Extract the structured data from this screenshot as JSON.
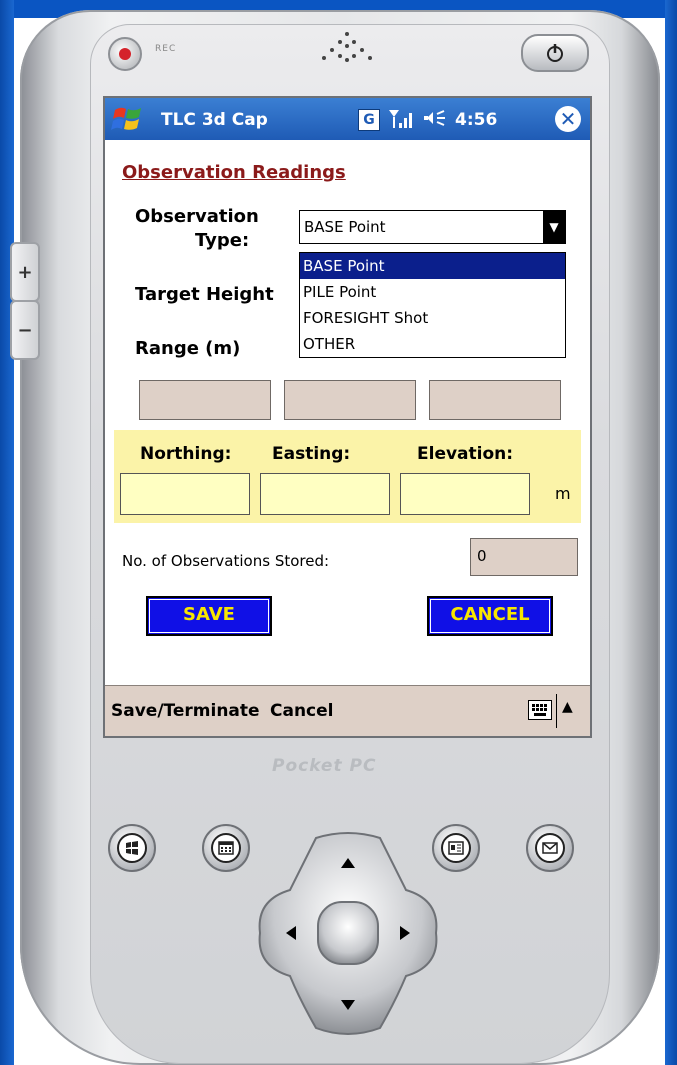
{
  "device": {
    "rec_label": "REC",
    "brand": "Pocket PC",
    "side_plus": "+",
    "side_minus": "−"
  },
  "titlebar": {
    "title": "TLC 3d Cap",
    "g_badge": "G",
    "time": "4:56"
  },
  "form": {
    "heading": "Observation Readings",
    "obs_type_label_1": "Observation",
    "obs_type_label_2": "Type:",
    "obs_type_value": "BASE Point",
    "obs_type_options": [
      "BASE Point",
      "PILE Point",
      "FORESIGHT Shot",
      "OTHER"
    ],
    "target_height_label": "Target Height",
    "range_label": "Range (m)",
    "northing_label": "Northing:",
    "easting_label": "Easting:",
    "elevation_label": "Elevation:",
    "unit": "m",
    "obs_stored_label": "No. of Observations Stored:",
    "obs_stored_value": "0",
    "save_label": "SAVE",
    "cancel_label": "CANCEL"
  },
  "menubar": {
    "left_label": "Save/Terminate",
    "right_label": "Cancel"
  },
  "colors": {
    "titlebar": "#1f5bb5",
    "heading": "#8b1a1a",
    "button_bg": "#1010e6",
    "button_text": "#f7e600",
    "panel_yellow": "#fbf3a8",
    "menubar": "#ded0c7"
  }
}
